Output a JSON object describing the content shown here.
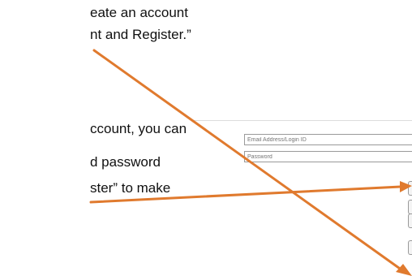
{
  "document": {
    "lines": [
      "eate an account",
      "nt and Register.”",
      "ccount, you can",
      "d password",
      "ster” to make"
    ]
  },
  "login_screenshot": {
    "email_placeholder": "Email Address/Login ID",
    "password_placeholder": "Password"
  },
  "colors": {
    "arrow": "#E07A2E",
    "text": "#111111"
  }
}
